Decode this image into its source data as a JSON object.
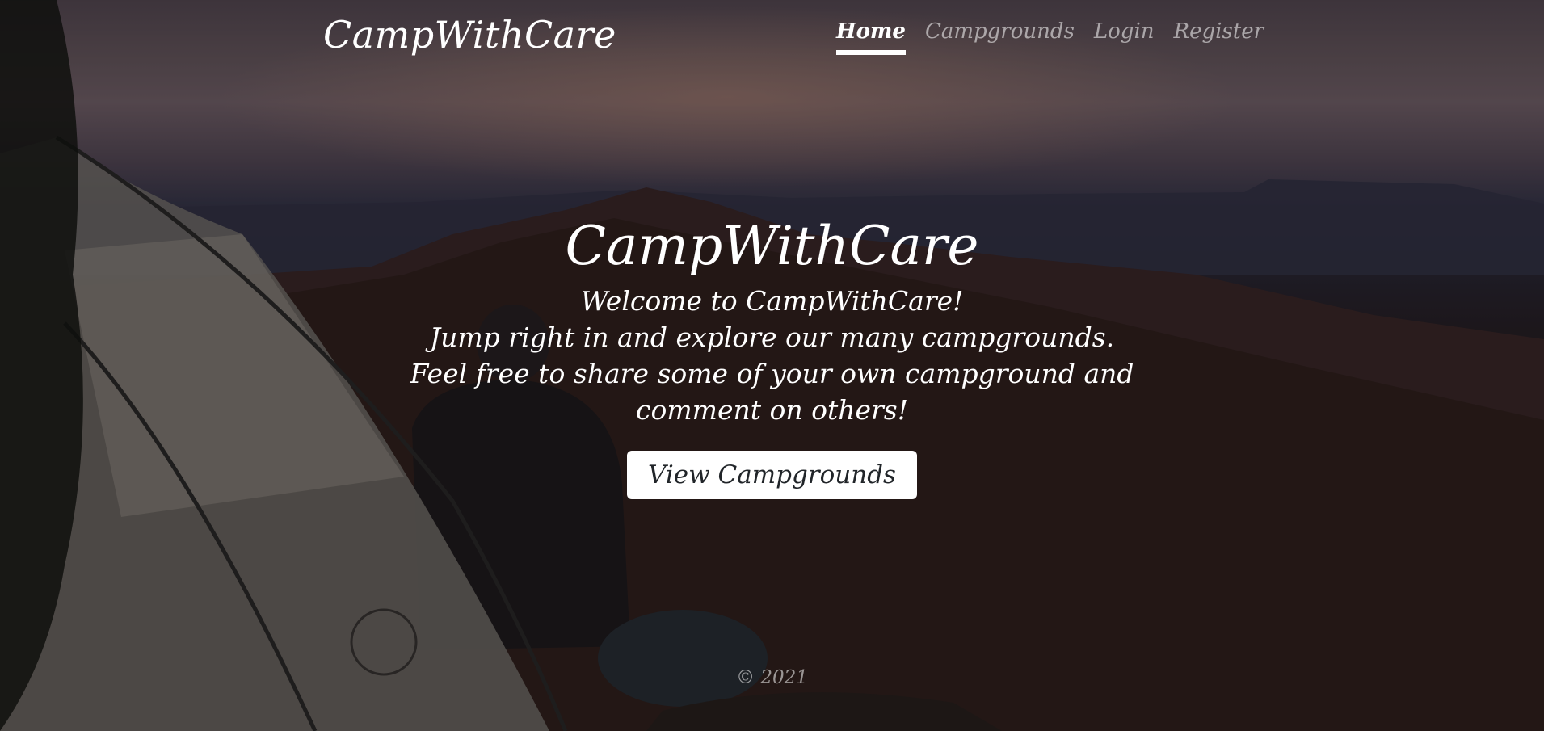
{
  "navbar": {
    "brand": "CampWithCare",
    "links": [
      {
        "label": "Home",
        "active": true
      },
      {
        "label": "Campgrounds",
        "active": false
      },
      {
        "label": "Login",
        "active": false
      },
      {
        "label": "Register",
        "active": false
      }
    ]
  },
  "hero": {
    "title": "CampWithCare",
    "lead": [
      "Welcome to CampWithCare!",
      "Jump right in and explore our many campgrounds.",
      "Feel free to share some of your own campground and comment on others!"
    ],
    "cta_label": "View Campgrounds"
  },
  "footer": {
    "text": "© 2021"
  },
  "colors": {
    "text": "#ffffff",
    "muted_text": "rgba(255,255,255,0.55)",
    "button_bg": "#ffffff",
    "button_text": "#212529"
  }
}
